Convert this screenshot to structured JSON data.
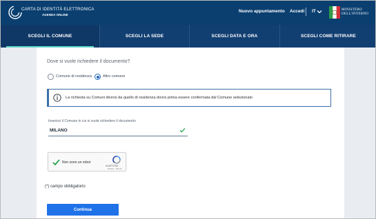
{
  "header": {
    "brand_title": "CARTA DI IDENTITÀ ELETTRONICA",
    "brand_subtitle": "AGENDA ONLINE",
    "nav_new_appointment": "Nuovo appuntamento",
    "nav_login": "Accedi",
    "language": "IT",
    "ministry_line1": "MINISTERO",
    "ministry_line2": "DELL'INTERNO"
  },
  "tabs": [
    {
      "label": "Scegli il comune",
      "active": true
    },
    {
      "label": "Scegli la sede",
      "active": false
    },
    {
      "label": "Scegli data e ora",
      "active": false
    },
    {
      "label": "Scegli come ritirare",
      "active": false
    }
  ],
  "form": {
    "question": "Dove si vuole richiedere il documento?",
    "radio_residence_label": "Comune di residenza",
    "radio_other_label": "Altro comune",
    "selected_option": "Altro comune",
    "alert_text": "La richiesta su Comuni diversi da quello di residenza dovrà prima essere confermata dal Comune selezionato",
    "municipality_label": "Inserisci il Comune in cui si vuole richiedere il documento",
    "municipality_value": "MILANO"
  },
  "captcha": {
    "label": "Non sono un robot",
    "brand": "reCAPTCHA",
    "links": "Privacy - Termini"
  },
  "required_note": "(*) campo obbligatorio",
  "submit_label": "Continua",
  "colors": {
    "header_bg": "#0a3f70",
    "tabs_bg": "#123f72",
    "active_underline": "#5fd7c7",
    "primary_button": "#1f72e8",
    "valid_check": "#2ea44f"
  }
}
